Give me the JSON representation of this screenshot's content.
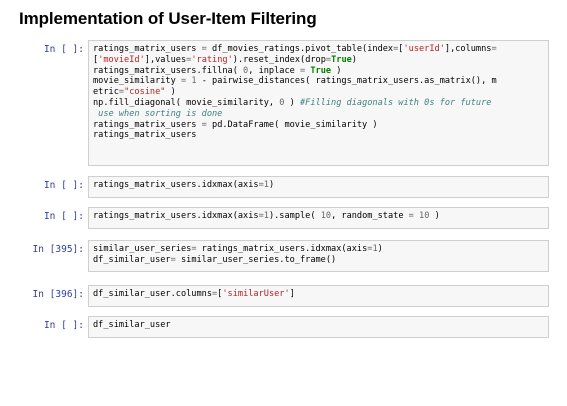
{
  "page": {
    "title": "Implementation of User-Item Filtering"
  },
  "cells": [
    {
      "prompt": "In [ ]:",
      "lines": [
        "ratings_matrix_users = df_movies_ratings.pivot_table(index=['userId'],columns=",
        "['movieId'],values='rating').reset_index(drop=True)",
        "ratings_matrix_users.fillna( 0, inplace = True )",
        "movie_similarity = 1 - pairwise_distances( ratings_matrix_users.as_matrix(), m",
        "etric=\"cosine\" )",
        "np.fill_diagonal( movie_similarity, 0 ) #Filling diagonals with 0s for future",
        " use when sorting is done",
        "ratings_matrix_users = pd.DataFrame( movie_similarity )",
        "ratings_matrix_users"
      ]
    },
    {
      "prompt": "In [ ]:",
      "lines": [
        "ratings_matrix_users.idxmax(axis=1)"
      ]
    },
    {
      "prompt": "In [ ]:",
      "lines": [
        "ratings_matrix_users.idxmax(axis=1).sample( 10, random_state = 10 )"
      ]
    },
    {
      "prompt": "In [395]:",
      "lines": [
        "similar_user_series= ratings_matrix_users.idxmax(axis=1)",
        "df_similar_user= similar_user_series.to_frame()"
      ]
    },
    {
      "prompt": "In [396]:",
      "lines": [
        "df_similar_user.columns=['similarUser']"
      ]
    },
    {
      "prompt": "In [ ]:",
      "lines": [
        "df_similar_user"
      ]
    }
  ]
}
